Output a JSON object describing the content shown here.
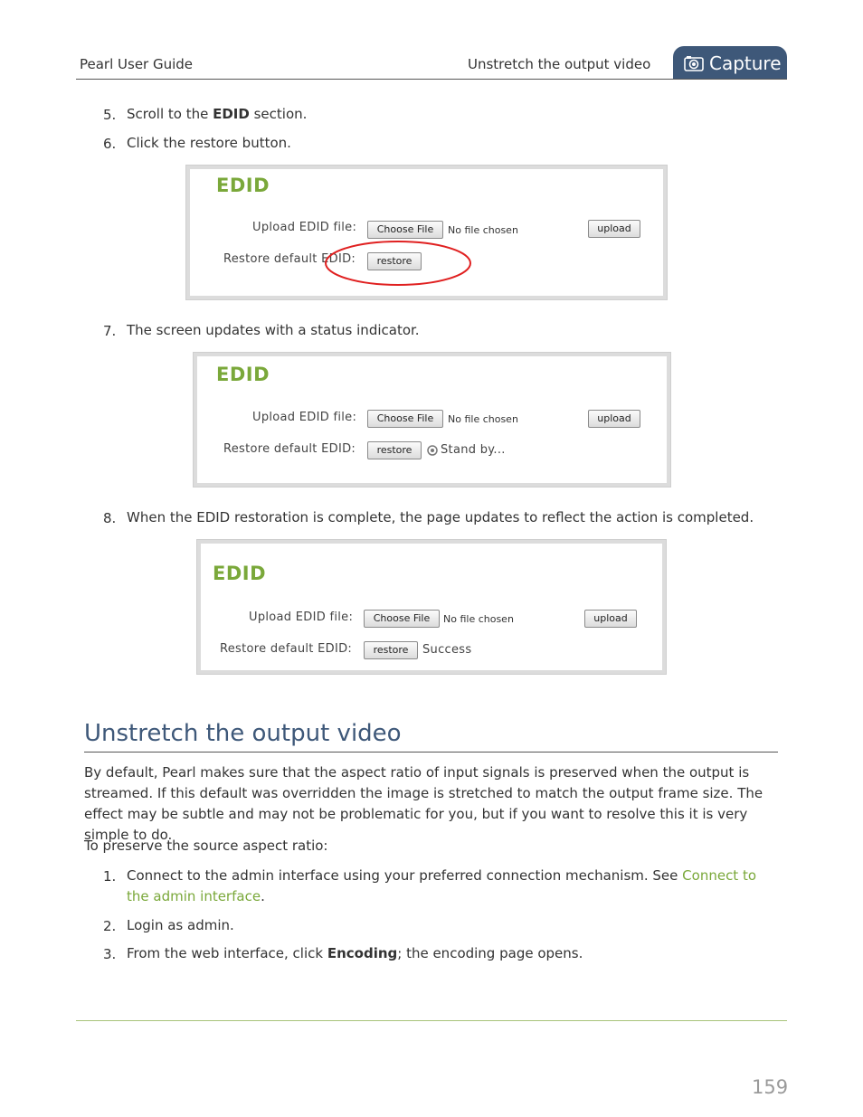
{
  "header": {
    "guide_title": "Pearl User Guide",
    "section_title": "Unstretch the output video",
    "tab_label": "Capture",
    "tab_icon": "camera-icon",
    "tab_color": "#3e5879"
  },
  "steps_top": [
    {
      "num": "5.",
      "pre": "Scroll to the ",
      "bold": "EDID",
      "post": " section."
    },
    {
      "num": "6.",
      "text": "Click the restore button."
    },
    {
      "num": "7.",
      "text": "The screen updates with a status indicator."
    },
    {
      "num": "8.",
      "text": "When the EDID restoration is complete, the page updates to reflect the action is completed."
    }
  ],
  "edid_panels": [
    {
      "title": "EDID",
      "upload_label": "Upload EDID file:",
      "choose_label": "Choose File",
      "no_file": "No file chosen",
      "upload_button": "upload",
      "restore_label": "Restore default EDID:",
      "restore_button": "restore",
      "status": "",
      "highlight": "red-ellipse"
    },
    {
      "title": "EDID",
      "upload_label": "Upload EDID file:",
      "choose_label": "Choose File",
      "no_file": "No file chosen",
      "upload_button": "upload",
      "restore_label": "Restore default EDID:",
      "restore_button": "restore",
      "status": "Stand by...",
      "status_icon": "spinner-icon"
    },
    {
      "title": "EDID",
      "upload_label": "Upload EDID file:",
      "choose_label": "Choose File",
      "no_file": "No file chosen",
      "upload_button": "upload",
      "restore_label": "Restore default EDID:",
      "restore_button": "restore",
      "status": "Success"
    }
  ],
  "section": {
    "heading": "Unstretch the output video",
    "intro": "By default, Pearl makes sure that the aspect ratio of input signals is preserved when the output is streamed. If this default was overridden the image is stretched to match the output frame size. The effect may be subtle and may not be problematic for you, but if you want to resolve this it is very simple to do.",
    "lead": "To preserve the source aspect ratio:",
    "steps": [
      {
        "num": "1.",
        "pre": "Connect to the admin interface using your preferred connection mechanism. See ",
        "link": "Connect to the admin interface",
        "post": "."
      },
      {
        "num": "2.",
        "text": "Login as admin."
      },
      {
        "num": "3.",
        "pre": "From the web interface, click ",
        "bold": "Encoding",
        "post": "; the encoding page opens."
      }
    ]
  },
  "footer": {
    "page_number": "159"
  },
  "colors": {
    "accent_green": "#7aa83a",
    "heading_blue": "#3e5879",
    "highlight_red": "#e02020"
  }
}
